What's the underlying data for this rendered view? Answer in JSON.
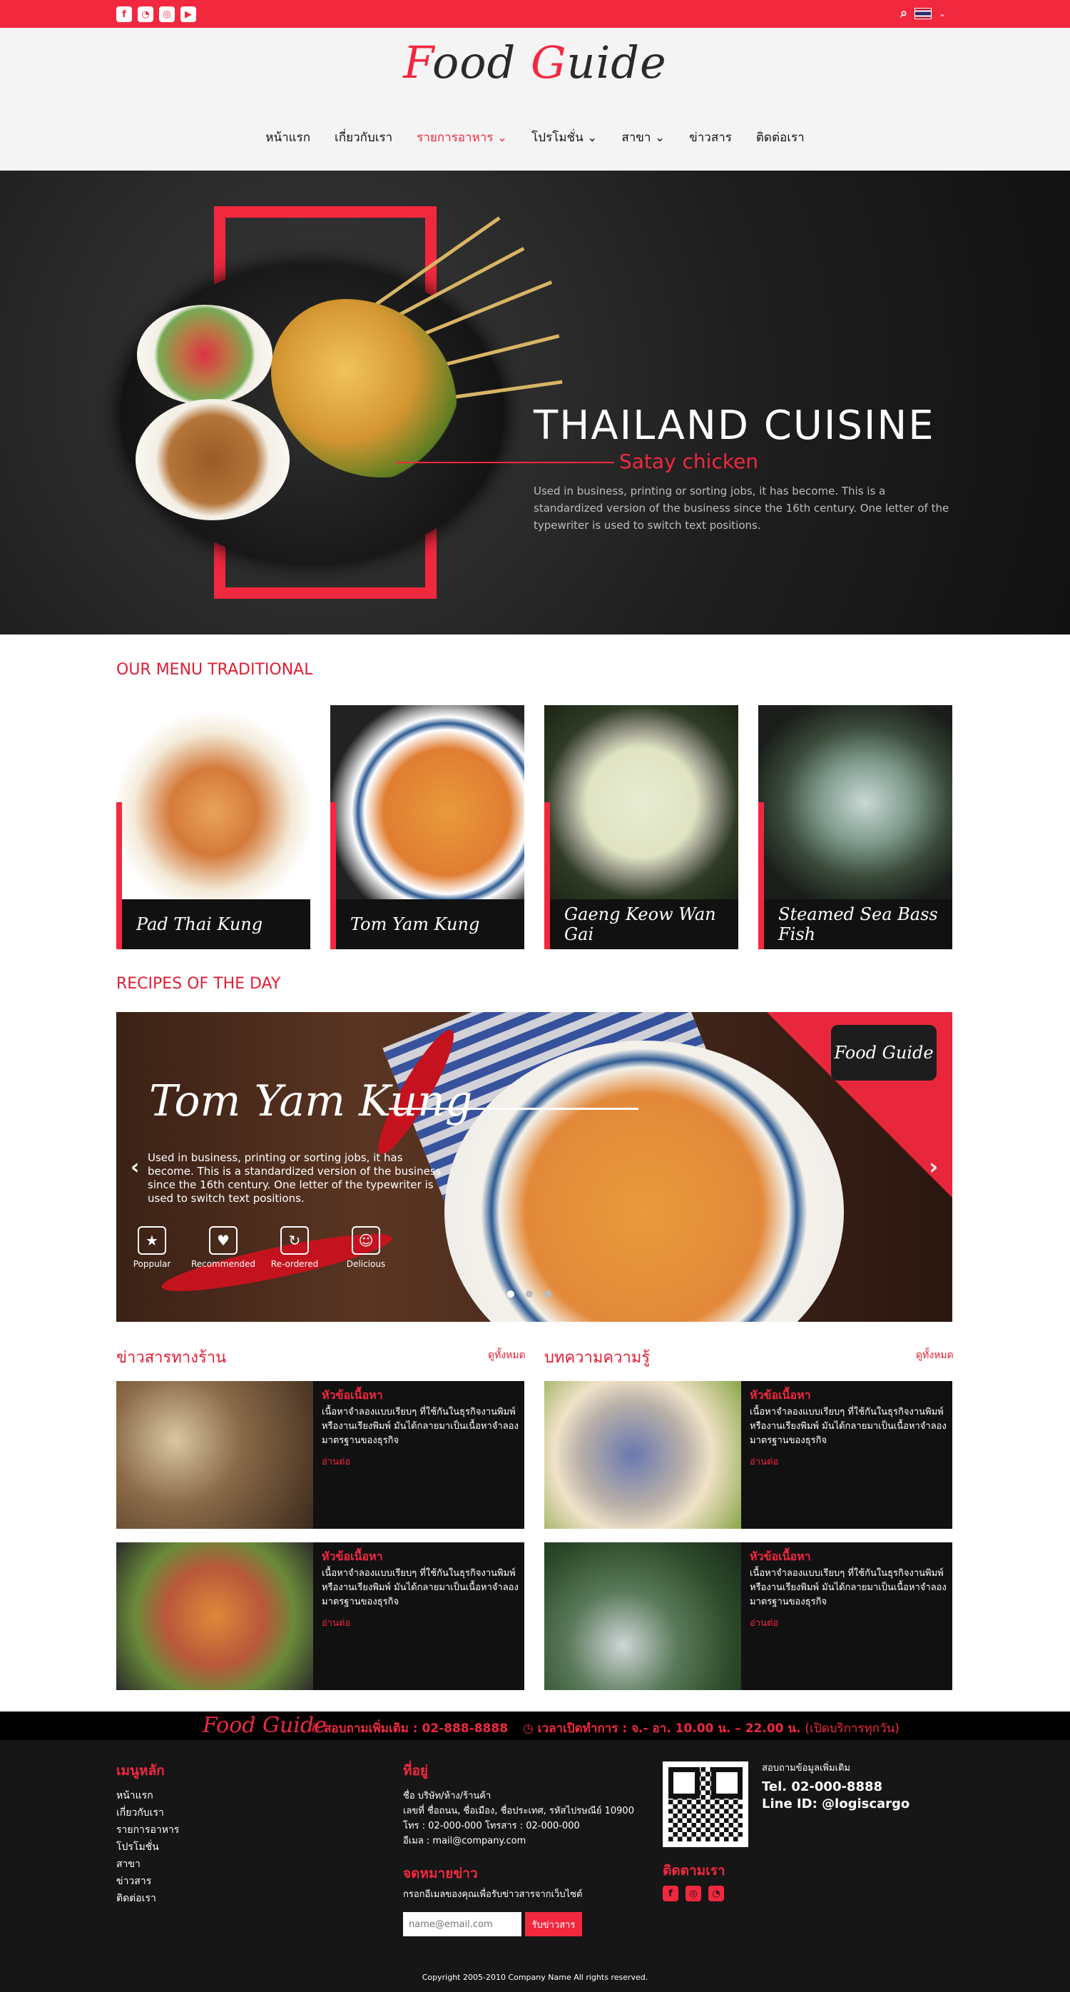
{
  "topbar": {
    "social_icons": [
      "facebook-icon",
      "line-icon",
      "instagram-icon",
      "youtube-icon"
    ],
    "search_icon": "search-icon",
    "language_icon": "thai-flag-icon"
  },
  "header": {
    "logo_text_1": "F",
    "logo_text_2": "ood ",
    "logo_text_3": "G",
    "logo_text_4": "uide",
    "nav": [
      {
        "label": "หน้าแรก",
        "active": false
      },
      {
        "label": "เกี่ยวกับเรา",
        "active": false
      },
      {
        "label": "รายการอาหาร",
        "active": true,
        "caret": true
      },
      {
        "label": "โปรโมชั่น",
        "active": false,
        "caret": true
      },
      {
        "label": "สาขา",
        "active": false,
        "caret": true
      },
      {
        "label": "ข่าวสาร",
        "active": false
      },
      {
        "label": "ติดต่อเรา",
        "active": false
      }
    ]
  },
  "hero": {
    "title": "THAILAND CUISINE",
    "subtitle": "Satay chicken",
    "description": "Used in business, printing or sorting jobs, it has become. This is a standardized version of the business since the 16th century. One letter of the typewriter is used to switch text positions."
  },
  "menu_section": {
    "title": "OUR MENU TRADITIONAL",
    "items": [
      {
        "name": "Pad Thai Kung"
      },
      {
        "name": "Tom Yam Kung"
      },
      {
        "name": "Gaeng Keow Wan Gai"
      },
      {
        "name": "Steamed Sea Bass Fish"
      }
    ]
  },
  "recipes": {
    "title": "RECIPES OF THE DAY",
    "dish": "Tom Yam Kung",
    "logo": "Food Guide",
    "description": "Used in business, printing or sorting jobs, it has become. This is a standardized version of the business since the 16th century. One letter of the typewriter is used to switch text positions.",
    "features": [
      "Poppular",
      "Recommended",
      "Re-ordered",
      "Delicious"
    ],
    "slide_count": 3,
    "active_slide": 1
  },
  "news": {
    "left_title": "ข่าวสารทางร้าน",
    "right_title": "บทความความรู้",
    "see_all": "ดูทั้งหมด",
    "item_title": "หัวข้อเนื้อหา",
    "item_desc": "เนื้อหาจำลองแบบเรียบๆ ที่ใช้กันในธุรกิจงานพิมพ์หรืองานเรียงพิมพ์ มันได้กลายมาเป็นเนื้อหาจำลองมาตรฐานของธุรกิจ",
    "item_more": "อ่านต่อ"
  },
  "contact_bar": {
    "logo": "Food Guide",
    "phone": "สอบถามเพิ่มเติม : 02-888-8888",
    "hours": "เวลาเปิดทำการ : จ.- อา. 10.00 น. – 22.00 น.",
    "hours_note": "(เปิดบริการทุกวัน)"
  },
  "footer": {
    "menu_title": "เมนูหลัก",
    "menu_items": [
      "หน้าแรก",
      "เกี่ยวกับเรา",
      "รายการอาหาร",
      "โปรโมชั่น",
      "สาขา",
      "ข่าวสาร",
      "ติดต่อเรา"
    ],
    "address_title": "ที่อยู่",
    "address_lines": [
      "ชื่อ บริษัท/ห้าง/ร้านค้า",
      "เลขที่ ชื่อถนน, ชื่อเมือง, ชื่อประเทศ, รหัสไปรษณีย์ 10900",
      "โทร : 02-000-000 โทรสาร : 02-000-000",
      "อีเมล : mail@company.com"
    ],
    "newsletter_title": "จดหมายข่าว",
    "newsletter_desc": "กรอกอีเมลของคุณเพื่อรับข่าวสารจากเว็บไซต์",
    "email_placeholder": "name@email.com",
    "subscribe_label": "รับข่าวสาร",
    "qr_heading": "สอบถามข้อมูลเพิ่มเติม",
    "qr_tel": "Tel. 02-000-8888",
    "qr_line": "Line ID: @logiscargo",
    "follow_title": "ติดตามเรา",
    "copyright": "Copyright 2005-2010 Company Name All rights reserved."
  }
}
